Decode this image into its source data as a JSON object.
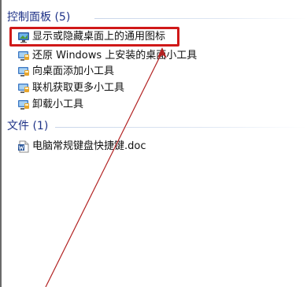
{
  "control_panel_group": {
    "header": "控制面板 (5)",
    "items": [
      {
        "label": "显示或隐藏桌面上的通用图标",
        "icon": "desktop-display-icon"
      },
      {
        "label": "还原 Windows 上安装的桌面小工具",
        "icon": "gadget-icon"
      },
      {
        "label": "向桌面添加小工具",
        "icon": "gadget-icon"
      },
      {
        "label": "联机获取更多小工具",
        "icon": "gadget-icon"
      },
      {
        "label": "卸载小工具",
        "icon": "gadget-icon"
      }
    ]
  },
  "files_group": {
    "header": "文件 (1)",
    "items": [
      {
        "label": "电脑常规键盘快捷键.doc",
        "icon": "word-document-icon"
      }
    ]
  },
  "annotation": {
    "highlight_color": "#d01919",
    "arrow_color": "#b22222"
  }
}
